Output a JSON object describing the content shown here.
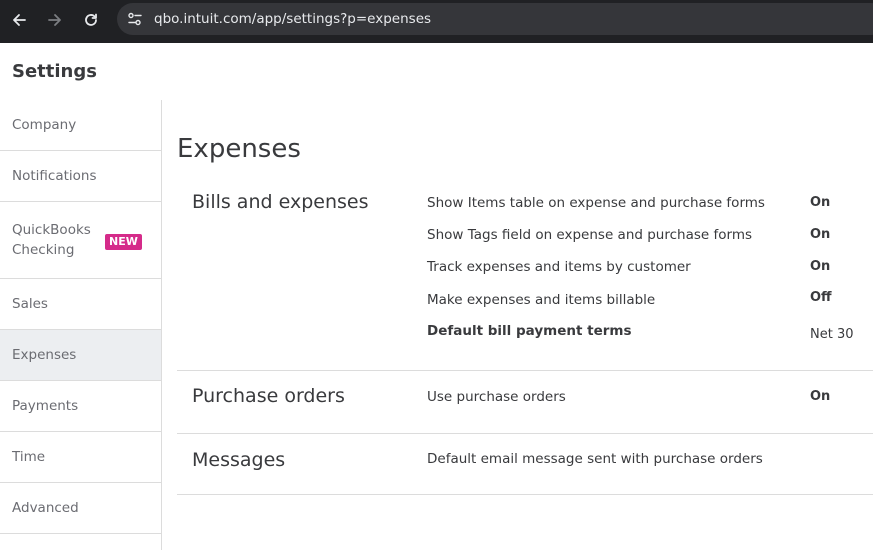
{
  "browser": {
    "url": "qbo.intuit.com/app/settings?p=expenses"
  },
  "header": {
    "title": "Settings"
  },
  "sidebar": {
    "items": [
      {
        "label": "Company"
      },
      {
        "label": "Notifications"
      },
      {
        "label": "QuickBooks Checking",
        "line1": "QuickBooks",
        "line2": "Checking",
        "badge": "NEW"
      },
      {
        "label": "Sales"
      },
      {
        "label": "Expenses",
        "active": true
      },
      {
        "label": "Payments"
      },
      {
        "label": "Time"
      },
      {
        "label": "Advanced"
      }
    ]
  },
  "main": {
    "title": "Expenses",
    "sections": [
      {
        "title": "Bills and expenses",
        "settings": [
          {
            "label": "Show Items table on expense and purchase forms",
            "value": "On"
          },
          {
            "label": "Show Tags field on expense and purchase forms",
            "value": "On"
          },
          {
            "label": "Track expenses and items by customer",
            "value": "On"
          },
          {
            "label": "Make expenses and items billable",
            "value": "Off"
          },
          {
            "label": "Default bill payment terms",
            "value": "Net 30"
          }
        ]
      },
      {
        "title": "Purchase orders",
        "settings": [
          {
            "label": "Use purchase orders",
            "value": "On"
          }
        ]
      },
      {
        "title": "Messages",
        "settings": [
          {
            "label": "Default email message sent with purchase orders",
            "value": ""
          }
        ]
      }
    ]
  },
  "colors": {
    "chrome_bg": "#202124",
    "address_bg": "#35363a",
    "badge_bg": "#d52b8a",
    "active_item_bg": "#eceef1",
    "text": "#393a3d",
    "muted_text": "#6b6c72",
    "divider": "#dcdcdc"
  },
  "icons": {
    "back": "arrow-left-icon",
    "forward": "arrow-right-icon",
    "reload": "reload-icon",
    "site_info": "tune-icon"
  }
}
